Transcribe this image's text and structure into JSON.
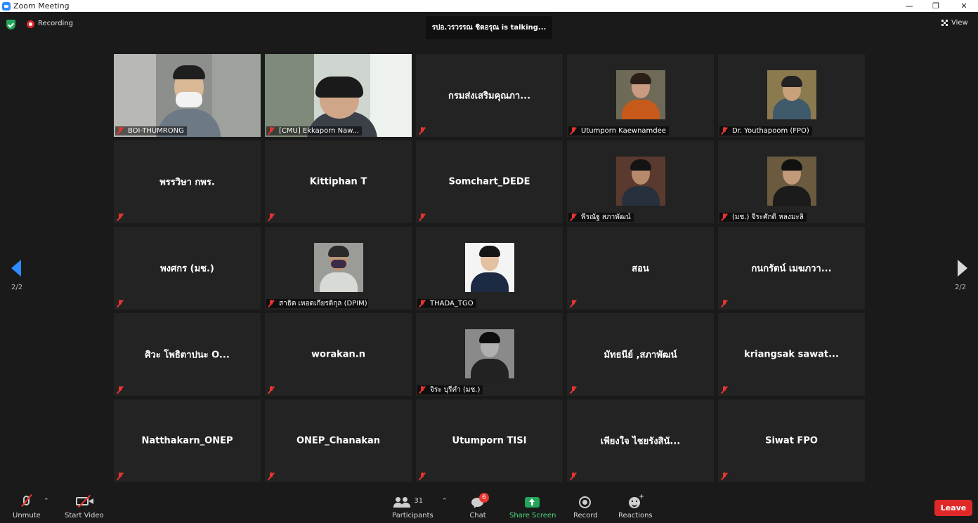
{
  "window": {
    "title": "Zoom Meeting",
    "controls": [
      "—",
      "❐",
      "✕"
    ]
  },
  "topbar": {
    "recording_label": "Recording",
    "talking": "รปอ.วรวรรณ ชิตอรุณ is talking...",
    "view_label": "View"
  },
  "navigation": {
    "page_indicator": "2/2"
  },
  "tiles": [
    {
      "type": "video",
      "name": "BOI-THUMRONG"
    },
    {
      "type": "video",
      "name": "[CMU] Ekkaporn  Naw..."
    },
    {
      "type": "text",
      "center": "กรมส่งเสริมคุณภา...",
      "name": ""
    },
    {
      "type": "photo",
      "name": "Utumporn Kaewnamdee"
    },
    {
      "type": "photo",
      "name": "Dr. Youthapoom (FPO)"
    },
    {
      "type": "text",
      "center": "พรรวิษา กพร.",
      "name": ""
    },
    {
      "type": "text",
      "center": "Kittiphan T",
      "name": ""
    },
    {
      "type": "text",
      "center": "Somchart_DEDE",
      "name": ""
    },
    {
      "type": "photo",
      "name": "พีรณัฐ สภาพัฒน์"
    },
    {
      "type": "photo",
      "name": "(มช.) จีระศักดิ์ หลงมะลิ"
    },
    {
      "type": "text",
      "center": "พงศกร (มช.)",
      "name": ""
    },
    {
      "type": "photo",
      "name": "สาธิต เหอดเกียรติกุล (DPIM)"
    },
    {
      "type": "photo",
      "name": "THADA_TGO"
    },
    {
      "type": "text",
      "center": "สอน",
      "name": ""
    },
    {
      "type": "text",
      "center": "กนกรัตน์ เมฆภวา...",
      "name": ""
    },
    {
      "type": "text",
      "center": "ศิวะ โพธิตาปนะ O...",
      "name": ""
    },
    {
      "type": "text",
      "center": "worakan.n",
      "name": ""
    },
    {
      "type": "photo",
      "name": "จิระ บุรีคำ (มช.)"
    },
    {
      "type": "text",
      "center": "มัทธนีย์ ,สภาพัฒน์",
      "name": ""
    },
    {
      "type": "text",
      "center": "kriangsak sawat...",
      "name": ""
    },
    {
      "type": "text",
      "center": "Natthakarn_ONEP",
      "name": ""
    },
    {
      "type": "text",
      "center": "ONEP_Chanakan",
      "name": ""
    },
    {
      "type": "text",
      "center": "Utumporn TISI",
      "name": ""
    },
    {
      "type": "text",
      "center": "เพียงใจ ไชยรังสินั...",
      "name": ""
    },
    {
      "type": "text",
      "center": "Siwat FPO",
      "name": ""
    }
  ],
  "toolbar": {
    "unmute": "Unmute",
    "start_video": "Start Video",
    "participants": "Participants",
    "participants_count": "31",
    "chat": "Chat",
    "chat_badge": "6",
    "share_screen": "Share Screen",
    "record": "Record",
    "reactions": "Reactions",
    "leave": "Leave"
  },
  "colors": {
    "accent": "#2d8cff",
    "share": "#23a55a",
    "leave": "#e02828",
    "muted": "#e8352e"
  }
}
